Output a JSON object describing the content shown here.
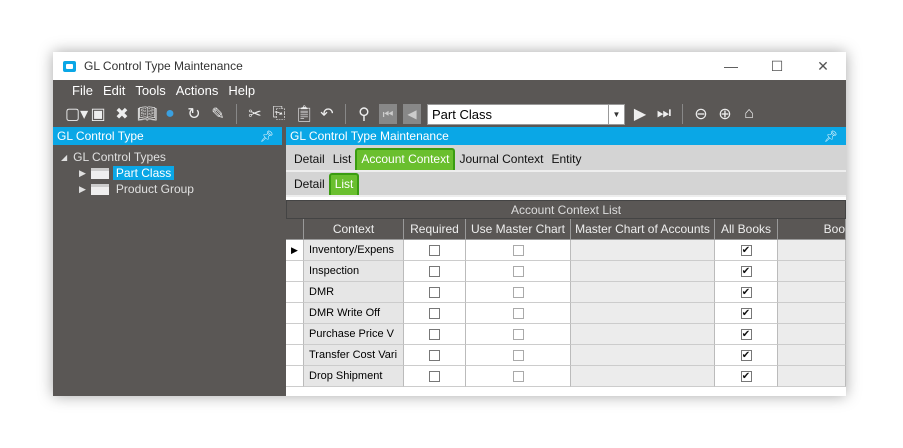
{
  "window": {
    "title": "GL Control Type Maintenance",
    "minimize": "—",
    "maximize": "☐",
    "close": "✕"
  },
  "menu": [
    "File",
    "Edit",
    "Tools",
    "Actions",
    "Help"
  ],
  "toolbar": {
    "combo_value": "Part Class"
  },
  "left_panel": {
    "title": "GL Control Type",
    "root": "GL Control Types",
    "items": [
      "Part Class",
      "Product Group"
    ]
  },
  "right_panel": {
    "title": "GL Control Type Maintenance",
    "tabs": [
      "Detail",
      "List",
      "Account Context",
      "Journal Context",
      "Entity"
    ],
    "subtabs": [
      "Detail",
      "List"
    ]
  },
  "grid": {
    "title": "Account Context List",
    "columns": [
      "Context",
      "Required",
      "Use Master Chart",
      "Master Chart of Accounts",
      "All Books",
      "Boo"
    ],
    "rows": [
      {
        "context": "Inventory/Expens",
        "required": false,
        "use_master": false,
        "all_books": true
      },
      {
        "context": "Inspection",
        "required": false,
        "use_master": false,
        "all_books": true
      },
      {
        "context": "DMR",
        "required": false,
        "use_master": false,
        "all_books": true
      },
      {
        "context": "DMR Write Off",
        "required": false,
        "use_master": false,
        "all_books": true
      },
      {
        "context": "Purchase Price V",
        "required": false,
        "use_master": false,
        "all_books": true
      },
      {
        "context": "Transfer Cost Vari",
        "required": false,
        "use_master": false,
        "all_books": true
      },
      {
        "context": "Drop Shipment",
        "required": false,
        "use_master": false,
        "all_books": true
      }
    ]
  }
}
